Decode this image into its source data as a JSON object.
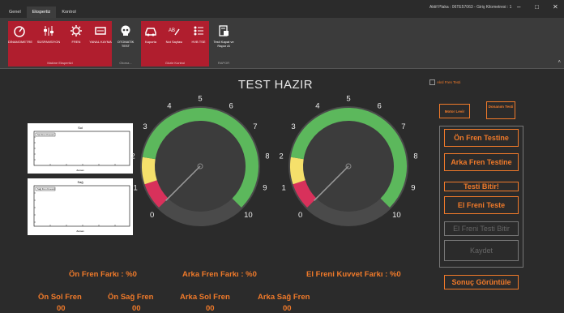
{
  "tabs": [
    {
      "label": "Genel",
      "active": false
    },
    {
      "label": "Ekspertiz",
      "active": true
    },
    {
      "label": "Kontrol",
      "active": false
    }
  ],
  "status_text": "Aktif Plaka : 06TE57063 - Giriş Kilometresi : 1",
  "window_controls": {
    "minimize": "–",
    "maximize": "□",
    "close": "✕"
  },
  "ribbon": {
    "groups": [
      {
        "title": "Makine Ekspertizi",
        "buttons": [
          "DİNAMOMETRE",
          "SÜSPANSİYON",
          "FREN",
          "YANAL KAYMA"
        ]
      },
      {
        "title": "Otoma...",
        "buttons": [
          "OTOMATİK TEST"
        ]
      },
      {
        "title": "Gözle Kontrol",
        "buttons": [
          "Kaporta",
          "Not Sayfası",
          "HVB TSE"
        ]
      },
      {
        "title": "RAPOR",
        "buttons": [
          "Testi Kapat ve Rapor Al"
        ]
      }
    ],
    "collapse": "˄"
  },
  "main_title": "TEST HAZIR",
  "el_fren_check": {
    "label": "Aksl Fren Testi",
    "checked": false
  },
  "plots": [
    {
      "title": "Sol",
      "xlabel": "Zaman",
      "legend": "Sol Fren Kuvveti"
    },
    {
      "title": "Sağ",
      "xlabel": "Zaman",
      "legend": "Sağ Fren Kuvveti"
    }
  ],
  "gauges": [
    {
      "value": 0,
      "min": 0,
      "max": 10,
      "ticks": [
        "0",
        "1",
        "2",
        "3",
        "4",
        "5",
        "6",
        "7",
        "8",
        "9",
        "10"
      ],
      "zones": {
        "red": [
          0,
          1
        ],
        "yellow": [
          1,
          2
        ],
        "green": [
          2,
          10
        ]
      }
    },
    {
      "value": 0,
      "min": 0,
      "max": 10,
      "ticks": [
        "0",
        "1",
        "2",
        "3",
        "4",
        "5",
        "6",
        "7",
        "8",
        "9",
        "10"
      ],
      "zones": {
        "red": [
          0,
          1
        ],
        "yellow": [
          1,
          2
        ],
        "green": [
          2,
          10
        ]
      }
    }
  ],
  "colors": {
    "accent": "#f07a2a",
    "red_zone": "#d8315b",
    "yellow_zone": "#f5e06b",
    "green_zone": "#5cb85c",
    "ribbon_red": "#b01e2e"
  },
  "side_buttons": {
    "motor_levir": "Motor Levir",
    "donanim_testi": "Donanım Testi",
    "on_fren_testine": "Ön Fren Testine",
    "arka_fren_testine": "Arka Fren Testine",
    "testi_bitir": "Testi Bitir!",
    "el_freni_teste": "El Freni Teste",
    "el_freni_testi_bitir": "El Freni Testi Bitir",
    "kaydet": "Kaydet",
    "sonuc_goruntule": "Sonuç Görüntüle"
  },
  "summary": {
    "on_fren_farki": "Ön Fren Farkı : %0",
    "arka_fren_farki": "Arka Fren Farkı : %0",
    "el_freni_kuvvet_farki": "El Freni Kuvvet Farkı : %0"
  },
  "brakes": [
    {
      "label": "Ön Sol Fren",
      "value": "00"
    },
    {
      "label": "Ön Sağ Fren",
      "value": "00"
    },
    {
      "label": "Arka Sol Fren",
      "value": "00"
    },
    {
      "label": "Arka Sağ Fren",
      "value": "00"
    }
  ]
}
